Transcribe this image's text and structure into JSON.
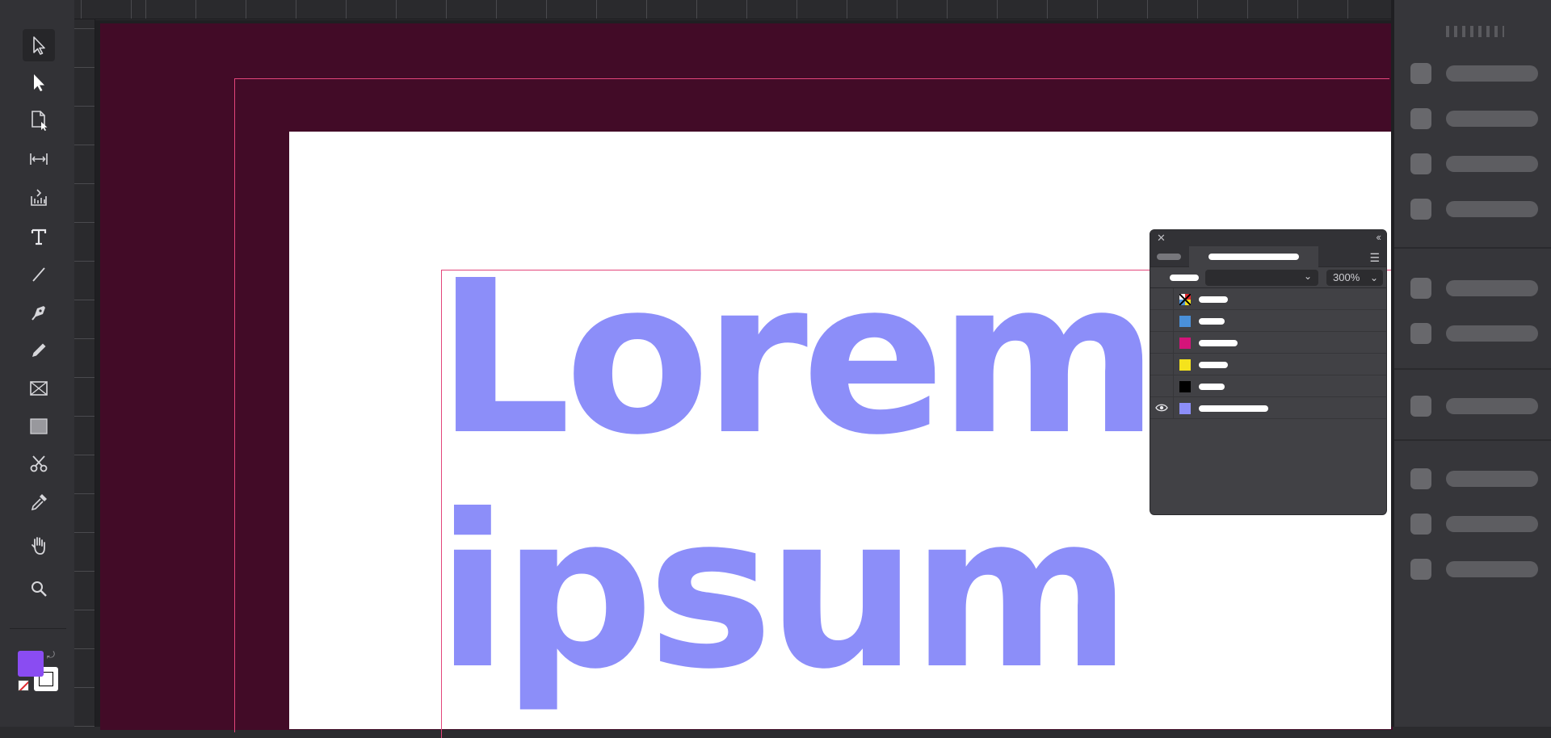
{
  "toolbar": {
    "tools": [
      {
        "name": "direct-selection-tool",
        "icon": "hollow-arrow-icon"
      },
      {
        "name": "selection-tool",
        "icon": "arrow-icon"
      },
      {
        "name": "page-tool",
        "icon": "page-icon"
      },
      {
        "name": "gap-tool",
        "icon": "gap-icon"
      },
      {
        "name": "content-collector-tool",
        "icon": "collector-icon"
      },
      {
        "name": "type-tool",
        "icon": "type-icon"
      },
      {
        "name": "line-tool",
        "icon": "line-icon"
      },
      {
        "name": "pen-tool",
        "icon": "pen-icon"
      },
      {
        "name": "pencil-tool",
        "icon": "pencil-icon"
      },
      {
        "name": "rectangle-frame-tool",
        "icon": "frame-icon"
      },
      {
        "name": "rectangle-tool",
        "icon": "rectangle-icon"
      },
      {
        "name": "scissors-tool",
        "icon": "scissors-icon"
      },
      {
        "name": "eyedropper-tool",
        "icon": "eyedropper-icon"
      },
      {
        "name": "hand-tool",
        "icon": "hand-icon"
      },
      {
        "name": "zoom-tool",
        "icon": "magnifier-icon"
      }
    ],
    "fill_color": "#8a4cf2",
    "stroke_color": "#ffffff"
  },
  "document": {
    "text_line_1": "Lorem",
    "text_line_2": "ipsum",
    "text_color": "#8c8ef9",
    "pasteboard_color": "#420b27",
    "guide_color": "#e3457a"
  },
  "swatches_panel": {
    "zoom": "300%",
    "swatches": [
      {
        "color": "registration",
        "visible": false
      },
      {
        "color": "#4a90d9",
        "visible": false
      },
      {
        "color": "#d4147a",
        "visible": false
      },
      {
        "color": "#f5e31c",
        "visible": false
      },
      {
        "color": "#000000",
        "visible": false
      },
      {
        "color": "#8c8ef9",
        "visible": true
      }
    ]
  }
}
